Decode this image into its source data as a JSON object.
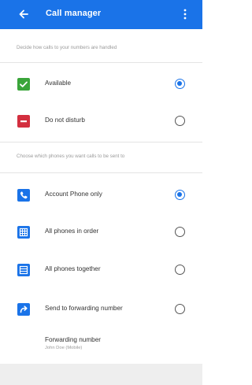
{
  "header": {
    "title": "Call manager",
    "back_icon": "arrow-left-icon",
    "more_icon": "more-vertical-icon",
    "color": "#1a73e8"
  },
  "status_section": {
    "hint": "Decide how calls to your numbers are handled",
    "items": [
      {
        "label": "Available",
        "icon": "check-icon",
        "icon_color": "#3aa53a",
        "selected": true
      },
      {
        "label": "Do not disturb",
        "icon": "minus-icon",
        "icon_color": "#d32f3f",
        "selected": false
      }
    ]
  },
  "phones_section": {
    "hint": "Choose which phones you want calls to be sent to",
    "items": [
      {
        "label": "Account Phone only",
        "icon": "phone-icon",
        "icon_color": "#1a73e8",
        "selected": true
      },
      {
        "label": "All phones in order",
        "icon": "grid-icon",
        "icon_color": "#1a73e8",
        "selected": false
      },
      {
        "label": "All phones together",
        "icon": "list-icon",
        "icon_color": "#1a73e8",
        "selected": false
      },
      {
        "label": "Send to forwarding number",
        "icon": "forward-arrow-icon",
        "icon_color": "#1a73e8",
        "selected": false
      }
    ]
  },
  "forwarding": {
    "title": "Forwarding number",
    "value": "John Doe (Mobile)"
  }
}
